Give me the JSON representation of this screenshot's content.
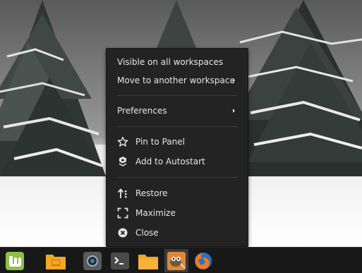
{
  "menu": {
    "items": [
      {
        "label": "Visible on all workspaces",
        "has_submenu": false
      },
      {
        "label": "Move to another workspace",
        "has_submenu": true
      },
      {
        "label": "Preferences",
        "has_submenu": true
      },
      {
        "label": "Pin to Panel",
        "icon": "star-icon"
      },
      {
        "label": "Add to Autostart",
        "icon": "autostart-icon"
      },
      {
        "label": "Restore",
        "icon": "restore-icon"
      },
      {
        "label": "Maximize",
        "icon": "maximize-icon"
      },
      {
        "label": "Close",
        "icon": "close-icon"
      }
    ]
  },
  "taskbar": {
    "items": [
      {
        "icon": "linux-mint-menu-icon"
      },
      {
        "icon": "desktop-folder-icon"
      },
      {
        "icon": "screenshot-tool-icon"
      },
      {
        "icon": "terminal-icon"
      },
      {
        "icon": "files-folder-icon"
      },
      {
        "icon": "gimp-icon",
        "active": true
      },
      {
        "icon": "firefox-icon"
      }
    ]
  },
  "colors": {
    "menu_bg": "#232323",
    "panel_bg": "#181818",
    "mint_green": "#8fc044",
    "folder_orange": "#f5a623"
  }
}
